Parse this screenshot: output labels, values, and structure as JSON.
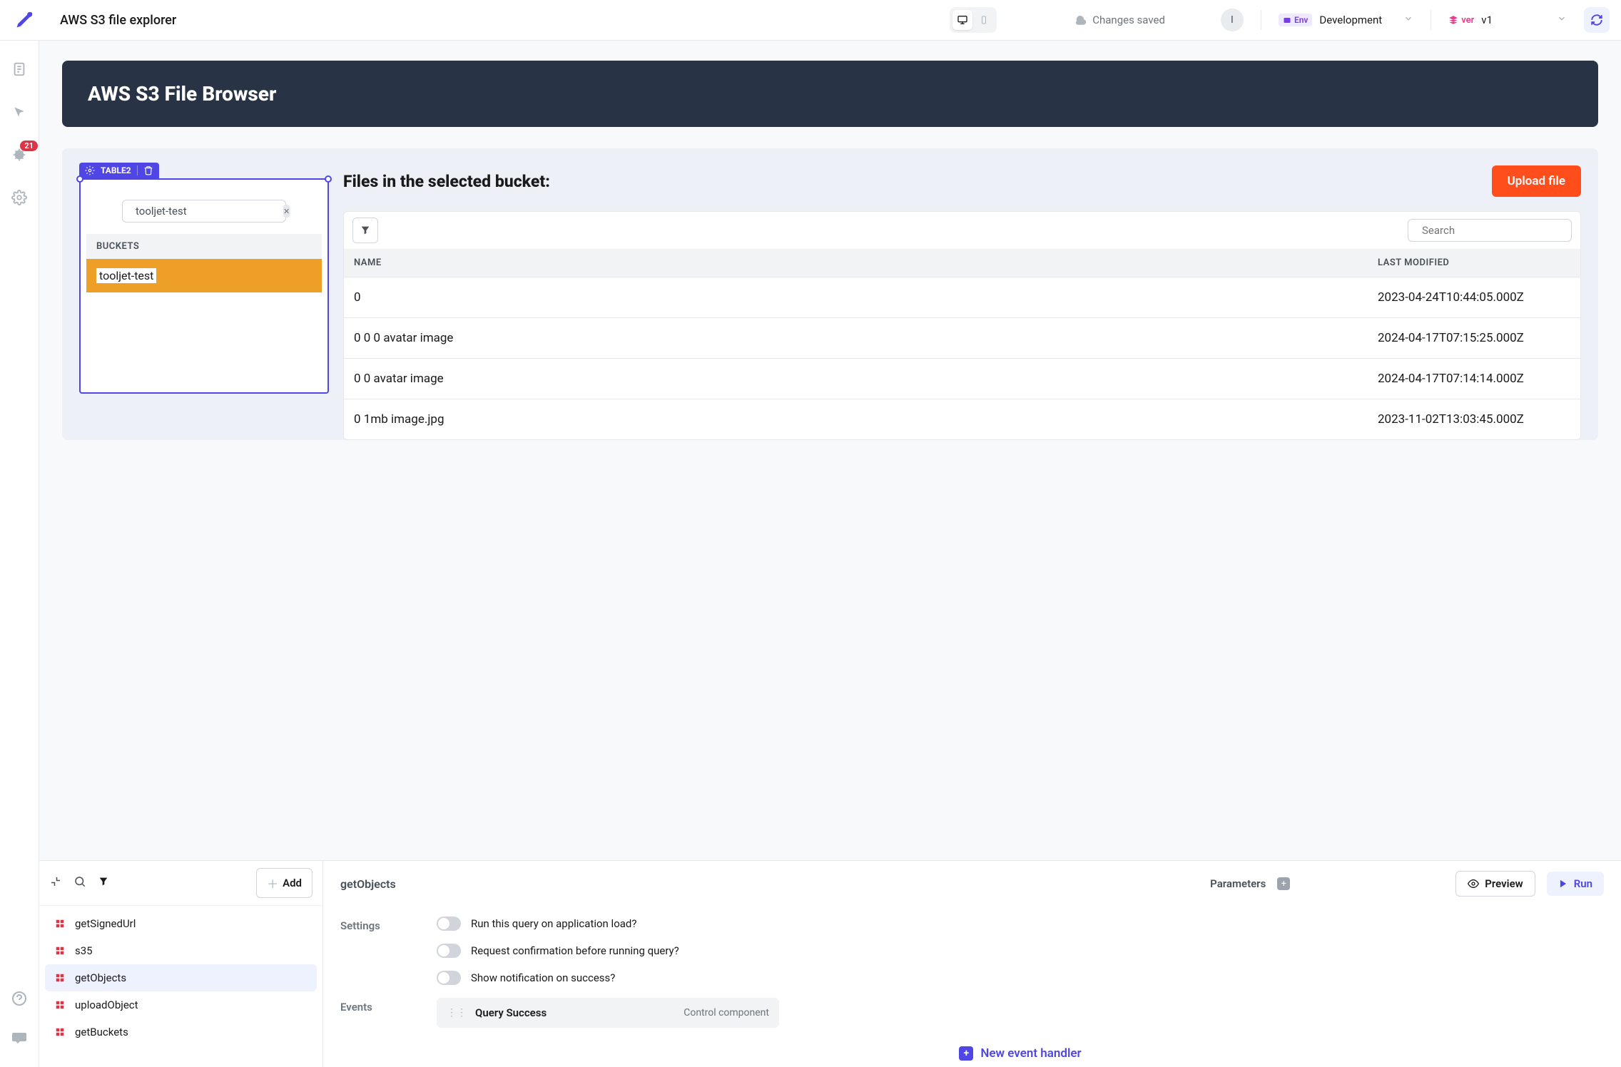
{
  "header": {
    "app_name": "AWS S3 file explorer",
    "save_status": "Changes saved",
    "avatar_initial": "I",
    "env_badge": "Env",
    "env_value": "Development",
    "ver_badge": "ver",
    "ver_value": "v1"
  },
  "rail": {
    "bug_count": "21"
  },
  "canvas": {
    "banner_title": "AWS S3 File Browser",
    "table_tag": "TABLE2",
    "bucket_search_value": "tooljet-test",
    "buckets_header": "BUCKETS",
    "bucket_row": "tooljet-test",
    "files_title": "Files in the selected bucket:",
    "upload_label": "Upload file",
    "files_search_placeholder": "Search",
    "col_name": "NAME",
    "col_modified": "LAST MODIFIED",
    "files": [
      {
        "name": "0",
        "modified": "2023-04-24T10:44:05.000Z"
      },
      {
        "name": "0 0 0 avatar image",
        "modified": "2024-04-17T07:15:25.000Z"
      },
      {
        "name": "0 0 avatar image",
        "modified": "2024-04-17T07:14:14.000Z"
      },
      {
        "name": "0 1mb image.jpg",
        "modified": "2023-11-02T13:03:45.000Z"
      }
    ]
  },
  "query": {
    "add_label": "Add",
    "items": [
      {
        "name": "getSignedUrl"
      },
      {
        "name": "s35"
      },
      {
        "name": "getObjects"
      },
      {
        "name": "uploadObject"
      },
      {
        "name": "getBuckets"
      }
    ],
    "active_index": 2,
    "main_title": "getObjects",
    "params_label": "Parameters",
    "preview_label": "Preview",
    "run_label": "Run",
    "settings_label": "Settings",
    "toggle1": "Run this query on application load?",
    "toggle2": "Request confirmation before running query?",
    "toggle3": "Show notification on success?",
    "events_label": "Events",
    "event_name": "Query Success",
    "event_action": "Control component",
    "new_event_label": "New event handler"
  }
}
